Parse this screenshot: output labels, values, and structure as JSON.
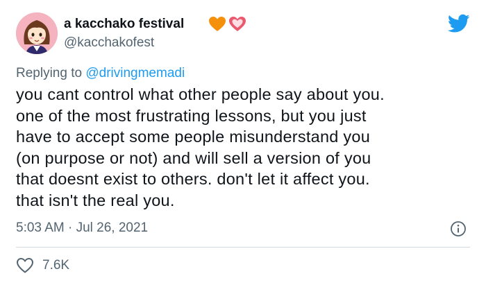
{
  "tweet": {
    "author": {
      "display_name": "a kacchako festival",
      "handle": "@kacchakofest",
      "name_emojis": [
        "orange-heart-icon",
        "sparkling-heart-icon"
      ]
    },
    "reply": {
      "prefix": "Replying to ",
      "mention": "@drivingmemadi"
    },
    "text_lines": [
      "you cant control what other people say about you.",
      "one of the most frustrating lessons, but you just",
      "have to accept some people misunderstand you",
      "(on purpose or not) and will sell a version of you",
      "that doesnt exist to others. don't let it affect you.",
      "that isn't the real you."
    ],
    "timestamp": "5:03 AM · Jul 26, 2021",
    "like_count": "7.6K"
  },
  "colors": {
    "text_primary": "#0f1419",
    "text_secondary": "#536471",
    "link": "#1d9bf0",
    "twitter_blue": "#1d9bf0",
    "divider": "#cfd9de"
  },
  "icons": {
    "brand": "twitter-bird-icon",
    "info": "info-icon",
    "like": "heart-outline-icon"
  }
}
